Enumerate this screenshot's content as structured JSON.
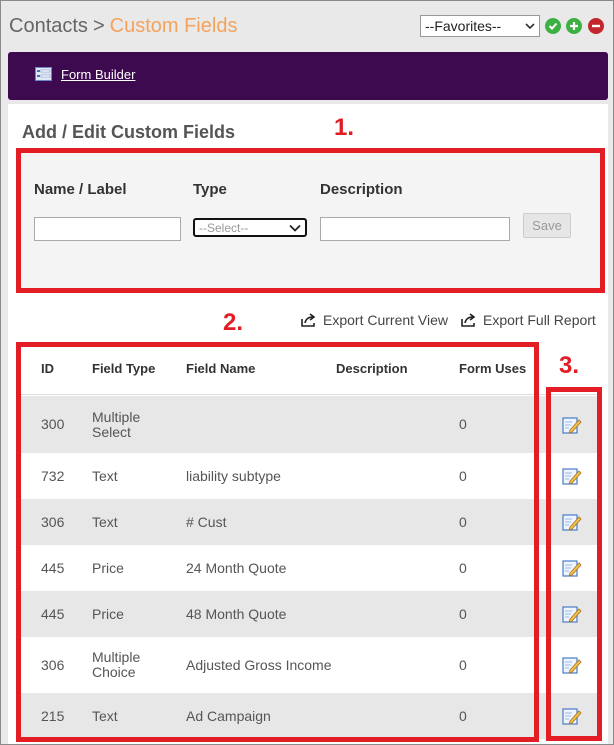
{
  "header": {
    "breadcrumb_root": "Contacts",
    "breadcrumb_separator": ">",
    "breadcrumb_current": "Custom Fields",
    "favorites_value": "--Favorites--"
  },
  "nav": {
    "form_builder_label": "Form Builder"
  },
  "section": {
    "title": "Add / Edit Custom Fields"
  },
  "form": {
    "name_label": "Name / Label",
    "type_label": "Type",
    "description_label": "Description",
    "name_value": "",
    "type_selected": "--Select--",
    "description_value": "",
    "save_label": "Save"
  },
  "export": {
    "current_view_label": "Export Current View",
    "full_report_label": "Export Full Report"
  },
  "table": {
    "columns": [
      "ID",
      "Field Type",
      "Field Name",
      "Description",
      "Form Uses"
    ],
    "rows": [
      {
        "id": "300",
        "field_type": "Multiple Select",
        "field_name": "",
        "description": "",
        "form_uses": "0"
      },
      {
        "id": "732",
        "field_type": "Text",
        "field_name": "liability subtype",
        "description": "",
        "form_uses": "0"
      },
      {
        "id": "306",
        "field_type": "Text",
        "field_name": "# Cust",
        "description": "",
        "form_uses": "0"
      },
      {
        "id": "445",
        "field_type": "Price",
        "field_name": "24 Month Quote",
        "description": "",
        "form_uses": "0"
      },
      {
        "id": "445",
        "field_type": "Price",
        "field_name": "48 Month Quote",
        "description": "",
        "form_uses": "0"
      },
      {
        "id": "306",
        "field_type": "Multiple Choice",
        "field_name": "Adjusted Gross Income",
        "description": "",
        "form_uses": "0"
      },
      {
        "id": "215",
        "field_type": "Text",
        "field_name": "Ad Campaign",
        "description": "",
        "form_uses": "0"
      }
    ]
  },
  "annotations": {
    "label_1": "1.",
    "label_2": "2.",
    "label_3": "3.",
    "color": "#e21d25"
  },
  "colors": {
    "nav_bg": "#3d0a4f",
    "breadcrumb_accent": "#f5a35c",
    "row_alt": "#e7e7e7"
  },
  "icons": {
    "check": "check-circle-icon",
    "plus": "plus-circle-icon",
    "minus": "minus-circle-icon",
    "form_builder": "form-builder-icon",
    "export": "export-icon",
    "edit": "edit-pencil-icon"
  }
}
